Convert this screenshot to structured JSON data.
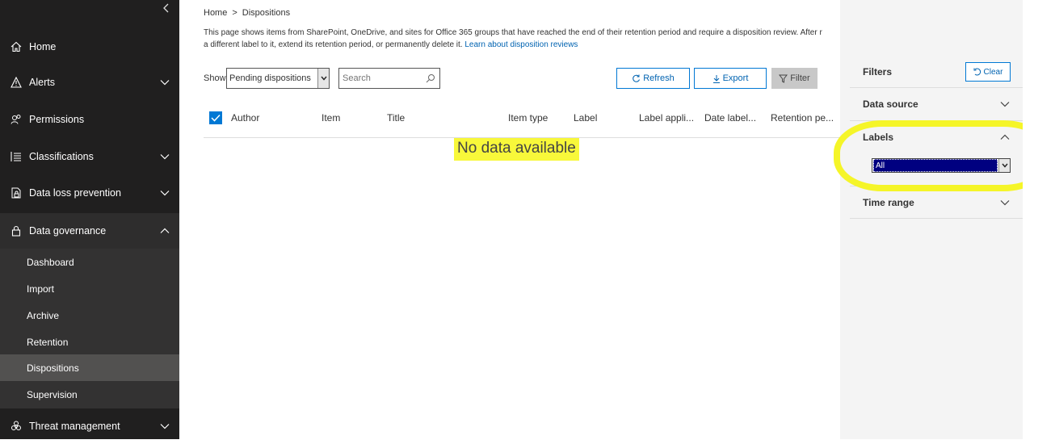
{
  "sidebar": {
    "items": [
      {
        "label": "Home",
        "icon": "home-icon",
        "chevron": ""
      },
      {
        "label": "Alerts",
        "icon": "alert-icon",
        "chevron": "down"
      },
      {
        "label": "Permissions",
        "icon": "people-icon",
        "chevron": ""
      },
      {
        "label": "Classifications",
        "icon": "list-icon",
        "chevron": "down"
      },
      {
        "label": "Data loss prevention",
        "icon": "document-lock-icon",
        "chevron": "down"
      },
      {
        "label": "Data governance",
        "icon": "lock-icon",
        "chevron": "up"
      },
      {
        "label": "Threat management",
        "icon": "biohazard-icon",
        "chevron": "down"
      }
    ],
    "subitems": [
      {
        "label": "Dashboard"
      },
      {
        "label": "Import"
      },
      {
        "label": "Archive"
      },
      {
        "label": "Retention"
      },
      {
        "label": "Dispositions",
        "active": true
      },
      {
        "label": "Supervision"
      }
    ]
  },
  "breadcrumb": {
    "home": "Home",
    "separator": ">",
    "current": "Dispositions"
  },
  "description": {
    "line1": "This page shows items from SharePoint, OneDrive, and sites for Office 365 groups that have reached the end of their retention period and require a disposition review. After r",
    "line2": "a different label to it, extend its retention period, or permanently delete it.",
    "link": "Learn about disposition reviews"
  },
  "toolbar": {
    "show_label": "Show",
    "show_value": "Pending dispositions",
    "search_placeholder": "Search",
    "refresh_label": "Refresh",
    "export_label": "Export",
    "filter_label": "Filter"
  },
  "table": {
    "columns": [
      "Author",
      "Item",
      "Title",
      "Item type",
      "Label",
      "Label appli...",
      "Date label...",
      "Retention pe..."
    ],
    "empty_text": "No data available"
  },
  "filters": {
    "title": "Filters",
    "clear_label": "Clear",
    "sections": [
      {
        "label": "Data source",
        "chevron": "down"
      },
      {
        "label": "Labels",
        "chevron": "up"
      },
      {
        "label": "Time range",
        "chevron": "down"
      }
    ],
    "labels_value": "All"
  },
  "colors": {
    "sidebar_bg": "#201f1f",
    "accent": "#0078d4",
    "highlight": "#f5f528",
    "active_subitem": "#525150"
  }
}
